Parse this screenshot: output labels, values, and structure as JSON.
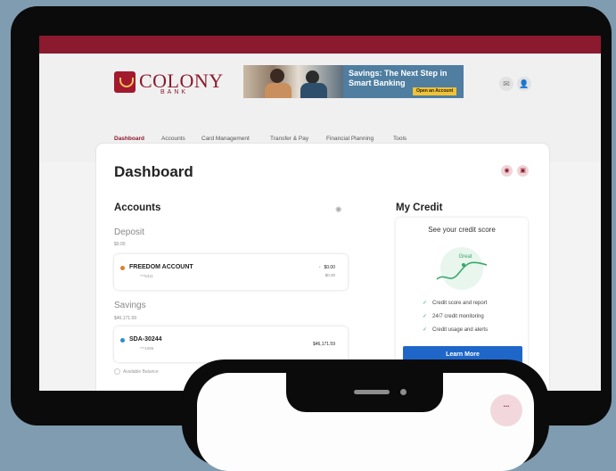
{
  "brand": {
    "name": "COLONY",
    "sub": "BANK",
    "color": "#8b1a2e"
  },
  "banner": {
    "text": "Savings: The Next Step in Smart Banking",
    "cta": "Open an Account"
  },
  "header_icons": [
    "mail-icon",
    "user-icon"
  ],
  "nav": {
    "items": [
      {
        "label": "Dashboard",
        "active": true
      },
      {
        "label": "Accounts"
      },
      {
        "label": "Card Management"
      },
      {
        "label": "Transfer & Pay"
      },
      {
        "label": "Financial Planning"
      },
      {
        "label": "Tools"
      }
    ]
  },
  "dashboard": {
    "title": "Dashboard"
  },
  "accounts": {
    "title": "Accounts",
    "deposit": {
      "label": "Deposit",
      "total": "$0.00",
      "account": {
        "name": "FREEDOM ACCOUNT",
        "number": "***5311",
        "balance": "$0.00",
        "available": "$0.00",
        "dot_color": "#d9822b"
      }
    },
    "savings": {
      "label": "Savings",
      "total": "$46,171.59",
      "account": {
        "name": "SDA-30244",
        "number": "***1086",
        "balance": "$46,171.59",
        "dot_color": "#2a8fd1"
      }
    },
    "available_label": "Available Balance"
  },
  "credit": {
    "title": "My Credit",
    "subtitle": "See your credit score",
    "graph_label": "Great",
    "features": [
      "Credit score and report",
      "24/7 credit monitoring",
      "Credit usage and alerts"
    ],
    "cta": "Learn More"
  },
  "phone": {
    "badge": "..."
  }
}
